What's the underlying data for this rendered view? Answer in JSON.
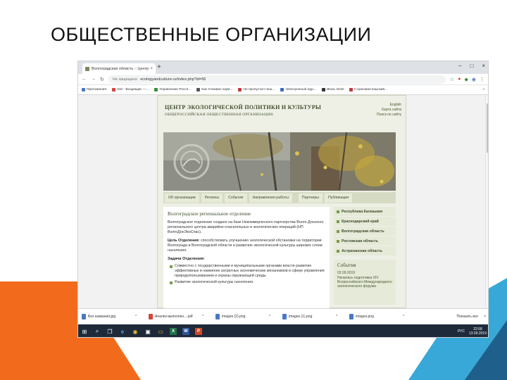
{
  "slide": {
    "title": "ОБЩЕСТВЕННЫЕ ОРГАНИЗАЦИИ"
  },
  "colors": {
    "orange": "#f26b1d",
    "blue": "#38a8d8",
    "dark_blue": "#1f5f8b",
    "site_green": "#3d4a2a"
  },
  "browser": {
    "tab_title": "Волгоградская область :: Центр",
    "tab_close": "×",
    "new_tab": "+",
    "window_controls": [
      "–",
      "□",
      "×"
    ],
    "nav_buttons": [
      "←",
      "→",
      "↻"
    ],
    "security": "Не защищено",
    "url": "ecologyandculture.ru/index.php?id=56",
    "extensions": [
      "☆",
      "●",
      "◆",
      "◉",
      "⋮"
    ],
    "bookmarks": [
      {
        "label": "Приложения",
        "color": "#4a78c2"
      },
      {
        "label": "310 - Входящие —...",
        "color": "#d9443a"
      },
      {
        "label": "Управление Росся...",
        "color": "#3a8a3a"
      },
      {
        "label": "Как Уложвал хаум...",
        "color": "#555555"
      },
      {
        "label": "Не пропустил пеш...",
        "color": "#c23a3a"
      },
      {
        "label": "Электронный жур...",
        "color": "#3a6ac2"
      },
      {
        "label": "Июнь 2018",
        "color": "#333333"
      },
      {
        "label": "Страховая взыскив...",
        "color": "#c23a3a"
      }
    ],
    "bookmarks_more": "»"
  },
  "site": {
    "name": "ЦЕНТР ЭКОЛОГИЧЕСКОЙ ПОЛИТИКИ И КУЛЬТУРЫ",
    "subtitle": "ОБЩЕРОССИЙСКАЯ ОБЩЕСТВЕННАЯ ОРГАНИЗАЦИЯ.",
    "links": [
      "English",
      "Карта сайта",
      "Поиск по сайту"
    ],
    "nav": [
      "Об организации",
      "Регионы",
      "События",
      "Направления работы",
      "Партнеры",
      "Публикации"
    ],
    "content": {
      "title": "Волгоградское региональное отделение",
      "intro": "Волгоградское отделение создано на базе Некоммерческого партнерства Волго-Донского регионального центра аварийно-спасательных и экологических операций (НП ВолгоДонЭкоСпас).",
      "goal_label": "Цель Отделения:",
      "goal_text": " способствовать улучшению экологической обстановки на территории Волгограда и Волгоградской области и развитию экологической культуры широких слоев населения.",
      "tasks_label": "Задачи Отделения:",
      "tasks": [
        "Совместно с государственными и муниципальными органами власти развитие эффективных и наименее затратных экономических механизмов в сфере управления природопользованием и охраны окружающей среды.",
        "Развитие экологической культуры населения."
      ]
    },
    "regions": [
      "Республика Калмыкия",
      "Краснодарский край",
      "Волгоградская область",
      "Ростовская область",
      "Астраханская область"
    ],
    "events": {
      "title": "События",
      "date": "02.09.2019",
      "text": "Началась подготовка XIV Всероссийского Международного экологического форума"
    }
  },
  "downloads": {
    "items": [
      {
        "name": "Без названия.jpg",
        "type": "img"
      },
      {
        "name": "Анализ выполнен....pdf",
        "type": "pdf"
      },
      {
        "name": "images (2).png",
        "type": "img"
      },
      {
        "name": "images (1).png",
        "type": "img"
      },
      {
        "name": "images.png",
        "type": "img"
      }
    ],
    "chevron": "^",
    "show_all": "Показать все",
    "close": "×"
  },
  "taskbar": {
    "icons": [
      {
        "name": "windows-start-icon",
        "glyph": "⊞"
      },
      {
        "name": "search-icon",
        "glyph": "⌕"
      },
      {
        "name": "task-view-icon",
        "glyph": "❐"
      },
      {
        "name": "edge-icon",
        "glyph": "e"
      },
      {
        "name": "chrome-icon",
        "glyph": "◉"
      },
      {
        "name": "store-icon",
        "glyph": "▣"
      },
      {
        "name": "explorer-icon",
        "glyph": "▭"
      },
      {
        "name": "excel-icon",
        "glyph": "X"
      },
      {
        "name": "word-icon",
        "glyph": "W"
      },
      {
        "name": "powerpoint-icon",
        "glyph": "P"
      }
    ],
    "language": "РУС",
    "time": "22:58",
    "date": "13.09.2019"
  }
}
